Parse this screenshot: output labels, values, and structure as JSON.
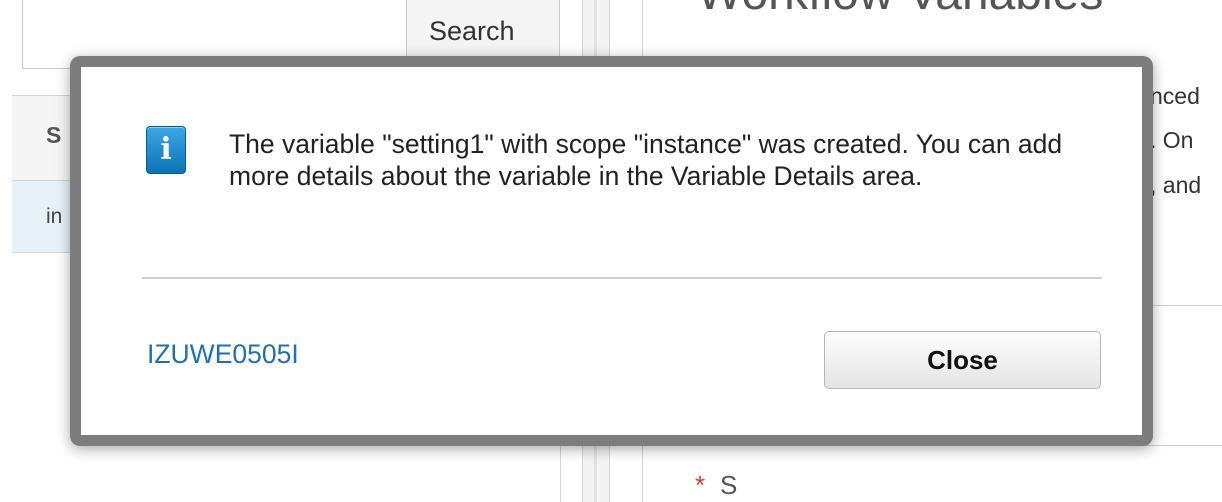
{
  "background": {
    "search_button_label": "Search",
    "table_header_fragment": "S",
    "table_row_fragment": "in",
    "right_title_fragment": "Workflow Variables",
    "right_text_fragments": [
      "nced",
      ". On",
      ", and"
    ],
    "required_marker": "*",
    "required_label_fragment": "S"
  },
  "dialog": {
    "icon": "info-icon",
    "message": "The variable \"setting1\" with scope \"instance\" was created. You can add more details about the variable in the Variable Details area.",
    "message_id": "IZUWE0505I",
    "close_label": "Close"
  },
  "colors": {
    "modal_border": "#7d7d7d",
    "link": "#1f6fb2",
    "info_icon": "#1a86cc",
    "row_selected": "#e9f1f8"
  }
}
